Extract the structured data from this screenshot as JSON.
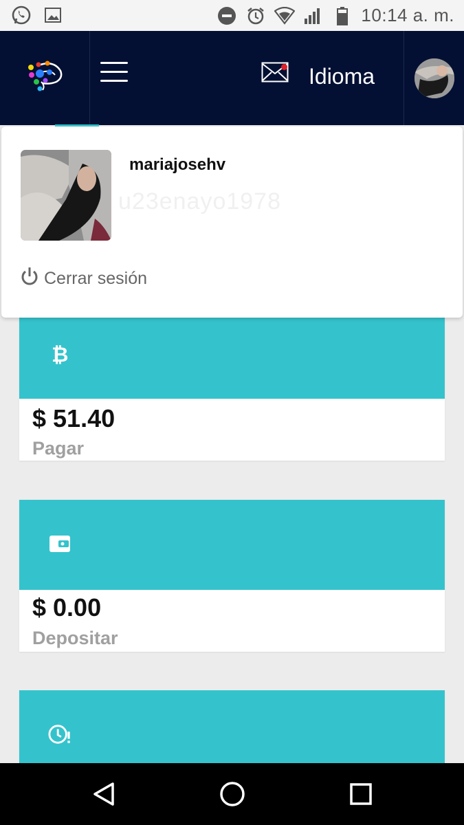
{
  "status_bar": {
    "time": "10:14 a. m.",
    "icons": [
      "whatsapp-icon",
      "image-icon",
      "do-not-disturb-icon",
      "alarm-icon",
      "wifi-icon",
      "signal-icon",
      "battery-icon"
    ]
  },
  "navbar": {
    "language_label": "Idioma",
    "icons": [
      "app-logo-icon",
      "hamburger-menu-icon",
      "mail-icon",
      "avatar"
    ],
    "colors": {
      "background": "#031033",
      "notification_dot": "#e0202a",
      "accent": "#34c3cc"
    }
  },
  "profile_dropdown": {
    "username": "mariajosehv",
    "ghost_text": "u23enayo1978",
    "logout_label": "Cerrar sesión",
    "logout_icon": "power-icon"
  },
  "cards": [
    {
      "icon": "bitcoin-icon",
      "amount": "$ 51.40",
      "label": "Pagar"
    },
    {
      "icon": "wallet-icon",
      "amount": "$ 0.00",
      "label": "Depositar"
    },
    {
      "icon": "clock-alert-icon"
    }
  ],
  "card_color": "#34c3cc",
  "bottom_nav": {
    "icons": [
      "back-icon",
      "home-icon",
      "recents-icon"
    ]
  }
}
